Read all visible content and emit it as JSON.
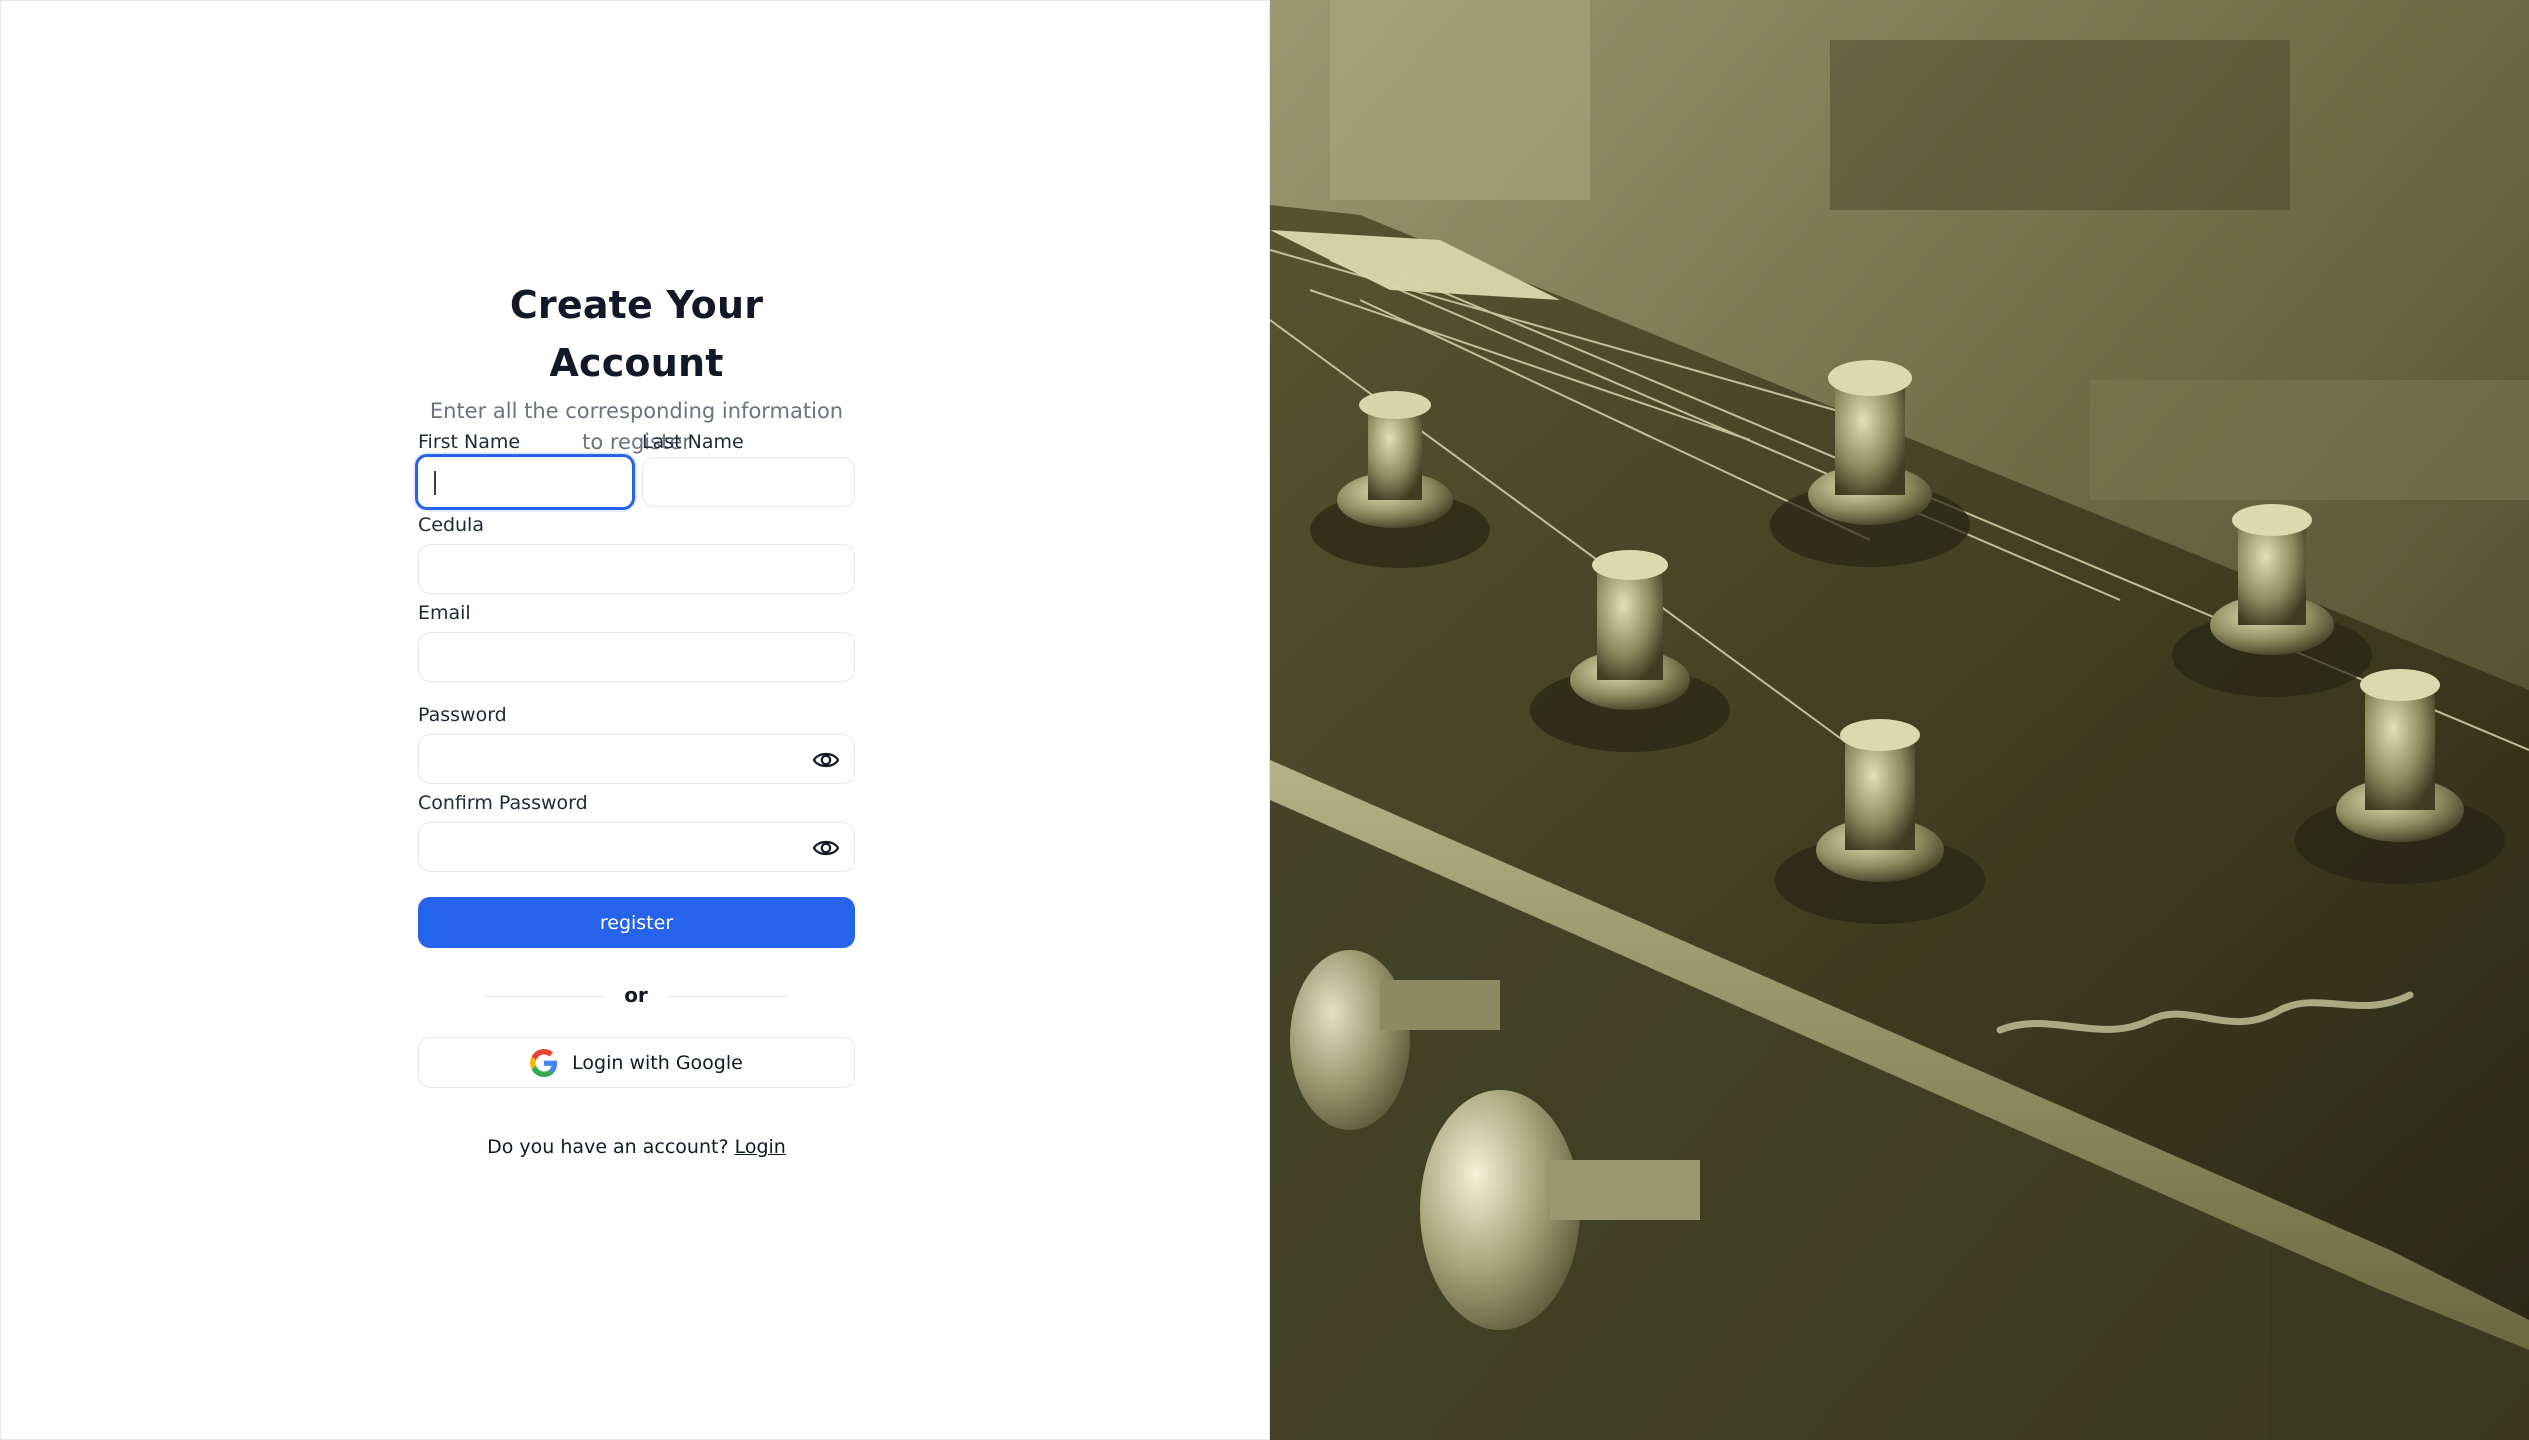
{
  "form": {
    "title": "Create Your Account",
    "subtitle": "Enter all the corresponding information to register",
    "first_name_label": "First Name",
    "last_name_label": "Last Name",
    "cedula_label": "Cedula",
    "email_label": "Email",
    "password_label": "Password",
    "confirm_password_label": "Confirm Password",
    "first_name_value": "",
    "last_name_value": "",
    "cedula_value": "",
    "email_value": "",
    "password_value": "",
    "confirm_password_value": "",
    "register_label": "register",
    "or_label": "or",
    "google_label": "Login with Google",
    "footer_text": "Do you have an account?",
    "login_link": "Login"
  },
  "icons": {
    "password_toggle": "eye-icon",
    "confirm_password_toggle": "eye-icon",
    "google": "google-logo-icon"
  },
  "colors": {
    "accent": "#2563eb",
    "background": "#ffffff",
    "photo_tint": "#8a8658"
  }
}
